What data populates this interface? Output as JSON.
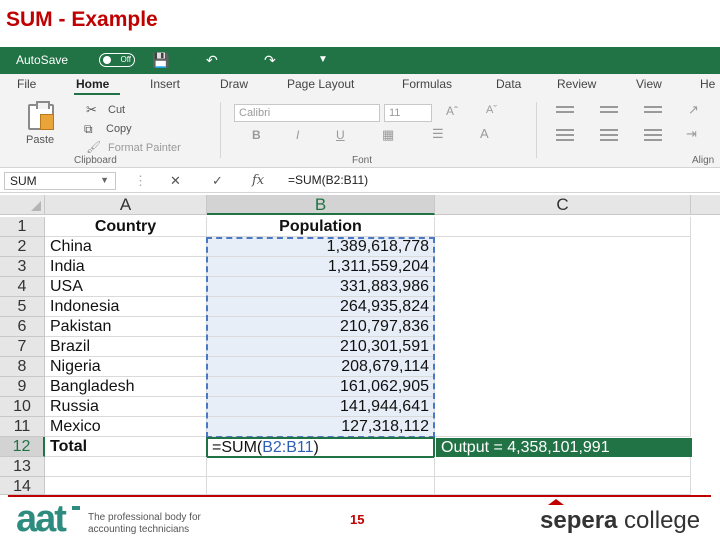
{
  "slide": {
    "title": "SUM - Example",
    "page_number": "15"
  },
  "titlebar": {
    "autosave_label": "AutoSave",
    "autosave_state": "Off",
    "color": "#217346"
  },
  "ribbon_tabs": [
    "File",
    "Home",
    "Insert",
    "Draw",
    "Page Layout",
    "Formulas",
    "Data",
    "Review",
    "View",
    "He"
  ],
  "ribbon": {
    "paste": "Paste",
    "cut": "Cut",
    "copy": "Copy",
    "format_painter": "Format Painter",
    "font_name": "Calibri",
    "font_size": "11",
    "bold": "B",
    "italic": "I",
    "underline": "U",
    "group_clipboard": "Clipboard",
    "group_font": "Font",
    "group_alignment": "Align"
  },
  "formula_bar": {
    "name_box": "SUM",
    "formula": "=SUM(B2:B11)"
  },
  "columns": [
    "A",
    "B",
    "C"
  ],
  "rows": [
    "1",
    "2",
    "3",
    "4",
    "5",
    "6",
    "7",
    "8",
    "9",
    "10",
    "11",
    "12",
    "13",
    "14"
  ],
  "table": {
    "headers": [
      "Country",
      "Population"
    ],
    "data": [
      [
        "China",
        "1,389,618,778"
      ],
      [
        "India",
        "1,311,559,204"
      ],
      [
        "USA",
        "331,883,986"
      ],
      [
        "Indonesia",
        "264,935,824"
      ],
      [
        "Pakistan",
        "210,797,836"
      ],
      [
        "Brazil",
        "210,301,591"
      ],
      [
        "Nigeria",
        "208,679,114"
      ],
      [
        "Bangladesh",
        "161,062,905"
      ],
      [
        "Russia",
        "141,944,641"
      ],
      [
        "Mexico",
        "127,318,112"
      ]
    ],
    "total_label": "Total",
    "formula_prefix": "=SUM(",
    "formula_range": "B2:B11",
    "formula_suffix": ")"
  },
  "output": "Output = 4,358,101,991",
  "footer": {
    "aat_logo": "aat",
    "aat_tagline": "The professional body for accounting technicians",
    "sepera_prefix": "sepera",
    "sepera_suffix": " college"
  }
}
